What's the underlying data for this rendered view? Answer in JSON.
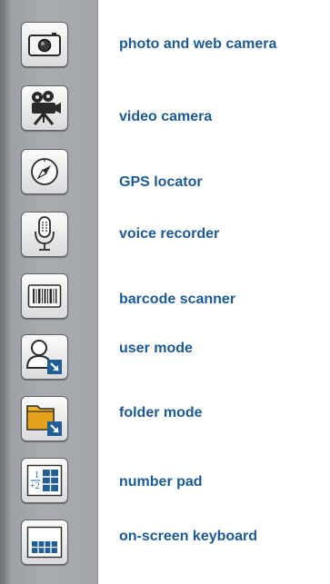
{
  "toolbar": {
    "items": [
      {
        "id": "camera",
        "icon": "camera-icon",
        "label": "photo and web camera"
      },
      {
        "id": "video",
        "icon": "movie-camera-icon",
        "label": "video camera"
      },
      {
        "id": "gps",
        "icon": "compass-icon",
        "label": "GPS locator"
      },
      {
        "id": "voice",
        "icon": "microphone-icon",
        "label": "voice recorder"
      },
      {
        "id": "barcode",
        "icon": "barcode-icon",
        "label": "barcode scanner"
      },
      {
        "id": "user",
        "icon": "user-mode-icon",
        "label": "user mode"
      },
      {
        "id": "folder",
        "icon": "folder-mode-icon",
        "label": "folder mode"
      },
      {
        "id": "numpad",
        "icon": "number-pad-icon",
        "label": "number pad"
      },
      {
        "id": "keyboard",
        "icon": "keyboard-icon",
        "label": "on-screen keyboard"
      }
    ]
  },
  "colors": {
    "label_text": "#1b5a99",
    "strip_background": "#a8abb0",
    "button_border": "#5e6166",
    "folder_yellow": "#f0b429",
    "arrow_badge_blue": "#1f5f95"
  }
}
